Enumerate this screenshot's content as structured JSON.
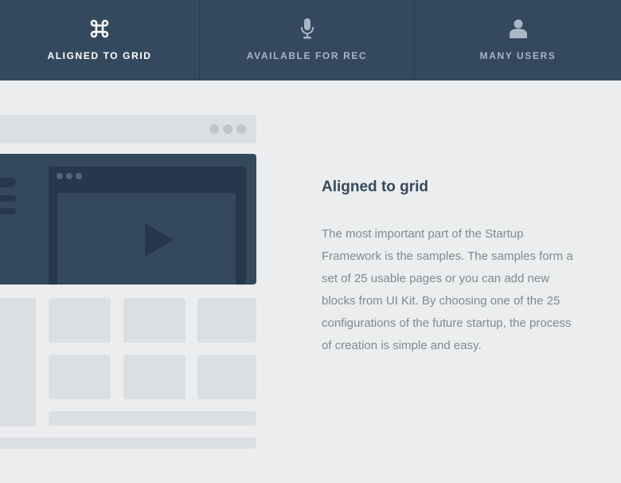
{
  "tabs": [
    {
      "label": "ALIGNED TO GRID",
      "icon": "command-icon",
      "active": true
    },
    {
      "label": "AVAILABLE FOR REC",
      "icon": "microphone-icon",
      "active": false
    },
    {
      "label": "MANY USERS",
      "icon": "user-icon",
      "active": false
    }
  ],
  "feature": {
    "title": "Aligned to grid",
    "description": "The most important part of the Startup Framework is the samples. The samples form a set of 25 usable pages or you can add new blocks from UI Kit. By choosing one of the 25 configurations of the future startup, the process of creation is simple and easy."
  },
  "colors": {
    "tabbar_bg": "#34495e",
    "active_text": "#ffffff",
    "inactive_text": "#a9b7c4",
    "page_bg": "#ebedef",
    "heading": "#34495e",
    "body_text": "#7f8c8d"
  }
}
